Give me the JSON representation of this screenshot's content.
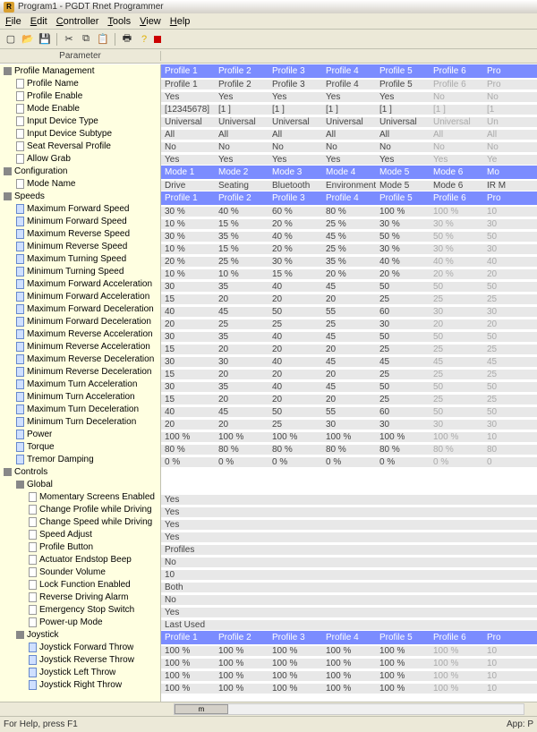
{
  "window": {
    "title": "Program1 - PGDT Rnet Programmer",
    "icon_letter": "R"
  },
  "menu": {
    "file": "File",
    "edit": "Edit",
    "controller": "Controller",
    "tools": "Tools",
    "view": "View",
    "help": "Help"
  },
  "header": {
    "parameter": "Parameter"
  },
  "profile_headers": {
    "p1": "Profile 1",
    "p2": "Profile 2",
    "p3": "Profile 3",
    "p4": "Profile 4",
    "p5": "Profile 5",
    "p6": "Profile 6",
    "p7": "Pro"
  },
  "mode_headers": {
    "m1": "Mode 1",
    "m2": "Mode 2",
    "m3": "Mode 3",
    "m4": "Mode 4",
    "m5": "Mode 5",
    "m6": "Mode 6",
    "m7": "Mo"
  },
  "tree": {
    "profile_management": "Profile Management",
    "profile_name": "Profile Name",
    "profile_enable": "Profile Enable",
    "mode_enable": "Mode Enable",
    "input_device_type": "Input Device Type",
    "input_device_subtype": "Input Device Subtype",
    "seat_reversal_profile": "Seat Reversal Profile",
    "allow_grab": "Allow Grab",
    "configuration": "Configuration",
    "mode_name": "Mode Name",
    "speeds": "Speeds",
    "max_fwd_speed": "Maximum Forward Speed",
    "min_fwd_speed": "Minimum Forward Speed",
    "max_rev_speed": "Maximum Reverse Speed",
    "min_rev_speed": "Minimum Reverse Speed",
    "max_turn_speed": "Maximum Turning Speed",
    "min_turn_speed": "Minimum Turning Speed",
    "max_fwd_accel": "Maximum Forward Acceleration",
    "min_fwd_accel": "Minimum Forward Acceleration",
    "max_fwd_decel": "Maximum Forward Deceleration",
    "min_fwd_decel": "Minimum Forward Deceleration",
    "max_rev_accel": "Maximum Reverse Acceleration",
    "min_rev_accel": "Minimum Reverse Acceleration",
    "max_rev_decel": "Maximum Reverse Deceleration",
    "min_rev_decel": "Minimum Reverse Deceleration",
    "max_turn_accel": "Maximum Turn Acceleration",
    "min_turn_accel": "Minimum Turn Acceleration",
    "max_turn_decel": "Maximum Turn Deceleration",
    "min_turn_decel": "Minimum Turn Deceleration",
    "power": "Power",
    "torque": "Torque",
    "tremor": "Tremor Damping",
    "controls": "Controls",
    "global": "Global",
    "momentary": "Momentary Screens Enabled",
    "chg_profile": "Change Profile while Driving",
    "chg_speed": "Change Speed while Driving",
    "speed_adjust": "Speed Adjust",
    "profile_button": "Profile Button",
    "actuator_beep": "Actuator Endstop Beep",
    "sounder_vol": "Sounder Volume",
    "lock_fn": "Lock Function Enabled",
    "rev_alarm": "Reverse Driving Alarm",
    "estop": "Emergency Stop Switch",
    "powerup": "Power-up Mode",
    "joystick": "Joystick",
    "joy_fwd": "Joystick Forward Throw",
    "joy_rev": "Joystick Reverse Throw",
    "joy_left": "Joystick Left Throw",
    "joy_right": "Joystick Right Throw"
  },
  "data": {
    "profile_name": [
      "Profile 1",
      "Profile 2",
      "Profile 3",
      "Profile 4",
      "Profile 5",
      "Profile 6",
      "Pro"
    ],
    "profile_enable": [
      "Yes",
      "Yes",
      "Yes",
      "Yes",
      "Yes",
      "No",
      "No"
    ],
    "mode_enable": [
      "[12345678]",
      "[1     ]",
      "[1     ]",
      "[1     ]",
      "[1     ]",
      "[1     ]",
      "[1"
    ],
    "input_device_type": [
      "Universal",
      "Universal",
      "Universal",
      "Universal",
      "Universal",
      "Universal",
      "Un"
    ],
    "input_device_subtype": [
      "All",
      "All",
      "All",
      "All",
      "All",
      "All",
      "All"
    ],
    "seat_reversal_profile": [
      "No",
      "No",
      "No",
      "No",
      "No",
      "No",
      "No"
    ],
    "allow_grab": [
      "Yes",
      "Yes",
      "Yes",
      "Yes",
      "Yes",
      "Yes",
      "Ye"
    ],
    "mode_name": [
      "Drive",
      "Seating",
      "Bluetooth",
      "Environmental",
      "Mode 5",
      "Mode 6",
      "IR M"
    ],
    "max_fwd_speed": [
      "30 %",
      "40 %",
      "60 %",
      "80 %",
      "100 %",
      "100 %",
      "10"
    ],
    "min_fwd_speed": [
      "10 %",
      "15 %",
      "20 %",
      "25 %",
      "30 %",
      "30 %",
      "30"
    ],
    "max_rev_speed": [
      "30 %",
      "35 %",
      "40 %",
      "45 %",
      "50 %",
      "50 %",
      "50"
    ],
    "min_rev_speed": [
      "10 %",
      "15 %",
      "20 %",
      "25 %",
      "30 %",
      "30 %",
      "30"
    ],
    "max_turn_speed": [
      "20 %",
      "25 %",
      "30 %",
      "35 %",
      "40 %",
      "40 %",
      "40"
    ],
    "min_turn_speed": [
      "10 %",
      "10 %",
      "15 %",
      "20 %",
      "20 %",
      "20 %",
      "20"
    ],
    "max_fwd_accel": [
      "30",
      "35",
      "40",
      "45",
      "50",
      "50",
      "50"
    ],
    "min_fwd_accel": [
      "15",
      "20",
      "20",
      "20",
      "25",
      "25",
      "25"
    ],
    "max_fwd_decel": [
      "40",
      "45",
      "50",
      "55",
      "60",
      "30",
      "30"
    ],
    "min_fwd_decel": [
      "20",
      "25",
      "25",
      "25",
      "30",
      "20",
      "20"
    ],
    "max_rev_accel": [
      "30",
      "35",
      "40",
      "45",
      "50",
      "50",
      "50"
    ],
    "min_rev_accel": [
      "15",
      "20",
      "20",
      "20",
      "25",
      "25",
      "25"
    ],
    "max_rev_decel": [
      "30",
      "30",
      "40",
      "45",
      "45",
      "45",
      "45"
    ],
    "min_rev_decel": [
      "15",
      "20",
      "20",
      "20",
      "25",
      "25",
      "25"
    ],
    "max_turn_accel": [
      "30",
      "35",
      "40",
      "45",
      "50",
      "50",
      "50"
    ],
    "min_turn_accel": [
      "15",
      "20",
      "20",
      "20",
      "25",
      "25",
      "25"
    ],
    "max_turn_decel": [
      "40",
      "45",
      "50",
      "55",
      "60",
      "50",
      "50"
    ],
    "min_turn_decel": [
      "20",
      "20",
      "25",
      "30",
      "30",
      "30",
      "30"
    ],
    "power": [
      "100 %",
      "100 %",
      "100 %",
      "100 %",
      "100 %",
      "100 %",
      "10"
    ],
    "torque": [
      "80 %",
      "80 %",
      "80 %",
      "80 %",
      "80 %",
      "80 %",
      "80"
    ],
    "tremor": [
      "0 %",
      "0 %",
      "0 %",
      "0 %",
      "0 %",
      "0 %",
      "0 "
    ],
    "momentary": "Yes",
    "chg_profile": "Yes",
    "chg_speed": "Yes",
    "speed_adjust": "Yes",
    "profile_button": "Profiles",
    "actuator_beep": "No",
    "sounder_vol": "10",
    "lock_fn": "Both",
    "rev_alarm": "No",
    "estop": "Yes",
    "powerup": "Last Used",
    "joy_fwd": [
      "100 %",
      "100 %",
      "100 %",
      "100 %",
      "100 %",
      "100 %",
      "10"
    ],
    "joy_rev": [
      "100 %",
      "100 %",
      "100 %",
      "100 %",
      "100 %",
      "100 %",
      "10"
    ],
    "joy_left": [
      "100 %",
      "100 %",
      "100 %",
      "100 %",
      "100 %",
      "100 %",
      "10"
    ],
    "joy_right": [
      "100 %",
      "100 %",
      "100 %",
      "100 %",
      "100 %",
      "100 %",
      "10"
    ]
  },
  "status": {
    "help": "For Help, press F1",
    "app": "App: P"
  },
  "scrollbar": {
    "thumb_label": "m"
  }
}
